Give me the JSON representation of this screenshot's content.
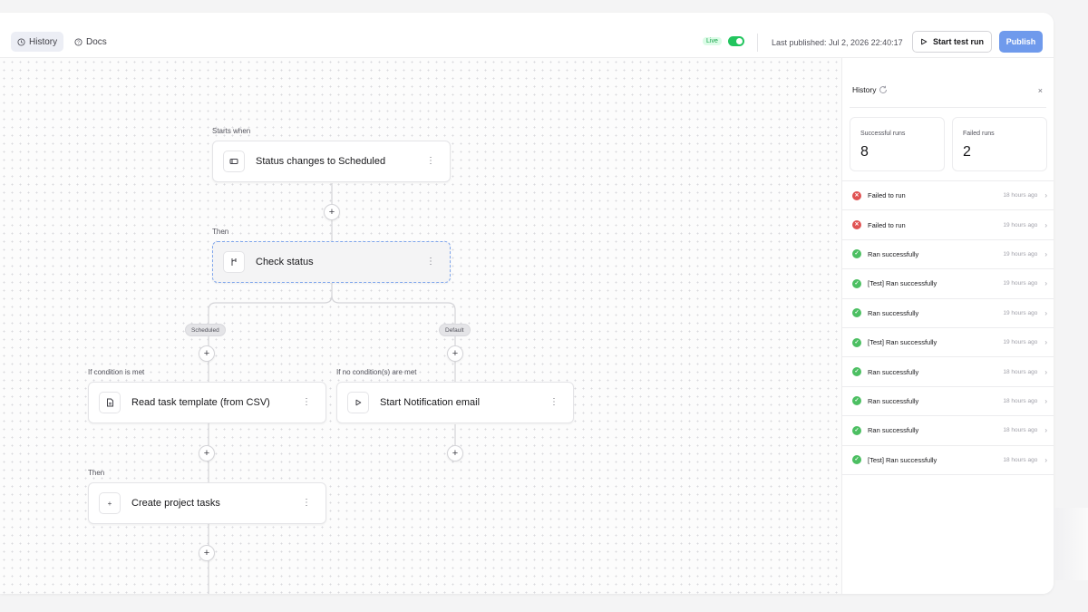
{
  "topbar": {
    "history_label": "History",
    "docs_label": "Docs",
    "live_badge": "Live",
    "live_enabled": true,
    "last_published": "Last published: Jul 2, 2026 22:40:17",
    "start_test_run": "Start test run",
    "publish": "Publish",
    "accent_color": "#6f9aec"
  },
  "canvas": {
    "trigger": {
      "section_label": "Starts when",
      "title": "Status changes to Scheduled",
      "icon": "status-tag-icon"
    },
    "then_label_1": "Then",
    "branch": {
      "title": "Check status",
      "icon": "branch-icon"
    },
    "branch_pill_left": "Scheduled",
    "branch_pill_right": "Default",
    "left_condition_label": "If condition is met",
    "right_condition_label": "If no condition(s) are met",
    "read_template": {
      "title": "Read task template (from CSV)",
      "icon": "document-icon"
    },
    "notification": {
      "title": "Start Notification email",
      "icon": "play-icon"
    },
    "then_label_2": "Then",
    "create_tasks": {
      "title": "Create project tasks",
      "icon": "plus-icon"
    }
  },
  "history": {
    "title": "History",
    "successful_label": "Successful runs",
    "successful_count": "8",
    "failed_label": "Failed runs",
    "failed_count": "2",
    "runs": [
      {
        "status": "failed",
        "label": "Failed to run",
        "time": "18 hours ago"
      },
      {
        "status": "failed",
        "label": "Failed to run",
        "time": "19 hours ago"
      },
      {
        "status": "success",
        "label": "Ran successfully",
        "time": "19 hours ago"
      },
      {
        "status": "success",
        "label": "[Test] Ran successfully",
        "time": "19 hours ago"
      },
      {
        "status": "success",
        "label": "Ran successfully",
        "time": "19 hours ago"
      },
      {
        "status": "success",
        "label": "[Test] Ran successfully",
        "time": "19 hours ago"
      },
      {
        "status": "success",
        "label": "Ran successfully",
        "time": "18 hours ago"
      },
      {
        "status": "success",
        "label": "Ran successfully",
        "time": "18 hours ago"
      },
      {
        "status": "success",
        "label": "Ran successfully",
        "time": "18 hours ago"
      },
      {
        "status": "success",
        "label": "[Test] Ran successfully",
        "time": "18 hours ago"
      }
    ]
  }
}
